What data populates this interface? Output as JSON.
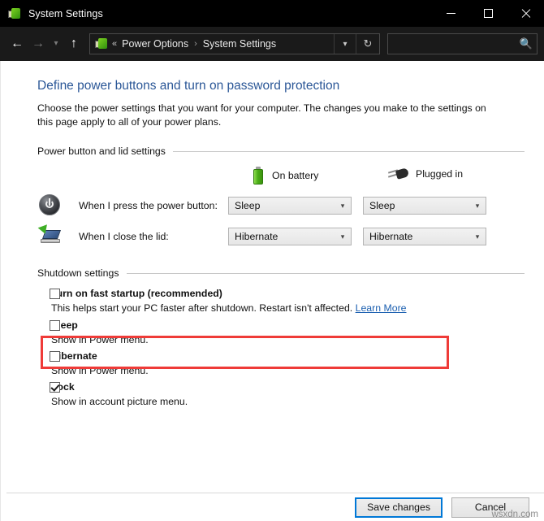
{
  "window": {
    "title": "System Settings",
    "icon": "system-settings-icon",
    "controls": {
      "minimize": "minimize-icon",
      "maximize": "maximize-icon",
      "close": "close-icon"
    }
  },
  "navbar": {
    "back": "back-arrow-icon",
    "forward": "forward-arrow-icon",
    "recent": "chevron-down-icon",
    "up": "up-arrow-icon",
    "breadcrumb": {
      "icon": "power-options-icon",
      "overflow": "«",
      "items": [
        "Power Options",
        "System Settings"
      ],
      "separator": "›",
      "dropdown": "chevron-down-icon",
      "refresh": "refresh-icon"
    },
    "search": {
      "value": "",
      "placeholder": "",
      "icon": "search-icon"
    }
  },
  "page": {
    "heading": "Define power buttons and turn on password protection",
    "description": "Choose the power settings that you want for your computer. The changes you make to the settings on this page apply to all of your power plans."
  },
  "power_group": {
    "label": "Power button and lid settings",
    "columns": [
      {
        "label": "On battery",
        "icon": "battery-icon"
      },
      {
        "label": "Plugged in",
        "icon": "power-plug-icon"
      }
    ],
    "rows": [
      {
        "icon": "power-button-icon",
        "label": "When I press the power button:",
        "on_battery": "Sleep",
        "plugged_in": "Sleep"
      },
      {
        "icon": "laptop-lid-icon",
        "label": "When I close the lid:",
        "on_battery": "Hibernate",
        "plugged_in": "Hibernate"
      }
    ]
  },
  "shutdown_group": {
    "label": "Shutdown settings",
    "items": [
      {
        "title": "Turn on fast startup (recommended)",
        "description": "This helps start your PC faster after shutdown. Restart isn't affected.",
        "link": "Learn More",
        "checked": false,
        "highlighted": true
      },
      {
        "title": "Sleep",
        "description": "Show in Power menu.",
        "link": "",
        "checked": false,
        "highlighted": false
      },
      {
        "title": "Hibernate",
        "description": "Show in Power menu.",
        "link": "",
        "checked": false,
        "highlighted": false
      },
      {
        "title": "Lock",
        "description": "Show in account picture menu.",
        "link": "",
        "checked": true,
        "highlighted": false
      }
    ]
  },
  "footer": {
    "save_label": "Save changes",
    "cancel_label": "Cancel"
  },
  "watermark": "wsxdn.com",
  "colors": {
    "heading": "#2b5797",
    "highlight": "#ef3b38",
    "link": "#1b5fb0",
    "accent": "#0078d7",
    "titlebar": "#000000",
    "navbar": "#1a1a1a"
  }
}
